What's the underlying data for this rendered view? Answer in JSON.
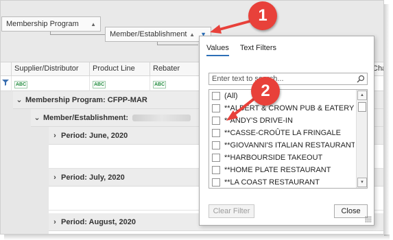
{
  "group_panel": {
    "chip1": {
      "label": "Membership Program"
    },
    "chip2": {
      "label": "Member/Establishment"
    }
  },
  "columns": [
    "Supplier/Distributor",
    "Product Line",
    "Rebater",
    "Cha"
  ],
  "filter_cell_icon": "ABC",
  "groups": [
    {
      "label": "Membership Program: CFPP-MAR"
    },
    {
      "label": "Member/Establishment:"
    },
    {
      "label": "Period: June, 2020"
    },
    {
      "label": "Period: July, 2020"
    },
    {
      "label": "Period: August, 2020"
    }
  ],
  "popup": {
    "tabs": [
      "Values",
      "Text Filters"
    ],
    "search_placeholder": "Enter text to search...",
    "items": [
      "(All)",
      "**ALBERT & CROWN PUB & EATERY",
      "**ANDY'S DRIVE-IN",
      "**CASSE-CROÛTE LA FRINGALE",
      "**GIOVANNI'S ITALIAN RESTAURANT",
      "**HARBOURSIDE TAKEOUT",
      "**HOME PLATE RESTAURANT",
      "**LA COAST RESTAURANT"
    ],
    "clear_label": "Clear Filter",
    "close_label": "Close"
  },
  "annotations": {
    "one": "1",
    "two": "2"
  },
  "colors": {
    "accent": "#2d6fb7",
    "callout": "#e8413a"
  }
}
